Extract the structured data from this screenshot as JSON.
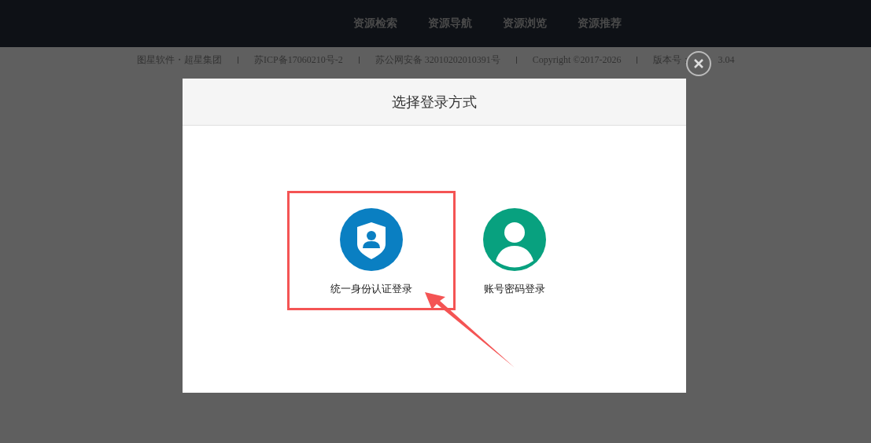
{
  "nav": [
    {
      "label": "资源检索"
    },
    {
      "label": "资源导航"
    },
    {
      "label": "资源浏览"
    },
    {
      "label": "资源推荐"
    }
  ],
  "footer": [
    "图星软件・超星集团",
    "苏ICP备17060210号-2",
    "苏公网安备 32010202010391号",
    "Copyright ©2017-2026",
    "版本号："
  ],
  "version_tail": "3.04",
  "dialog": {
    "title": "选择登录方式",
    "options": [
      {
        "kind": "shield",
        "label": "统一身份认证登录",
        "selected": true
      },
      {
        "kind": "person",
        "label": "账号密码登录",
        "selected": false
      }
    ]
  }
}
